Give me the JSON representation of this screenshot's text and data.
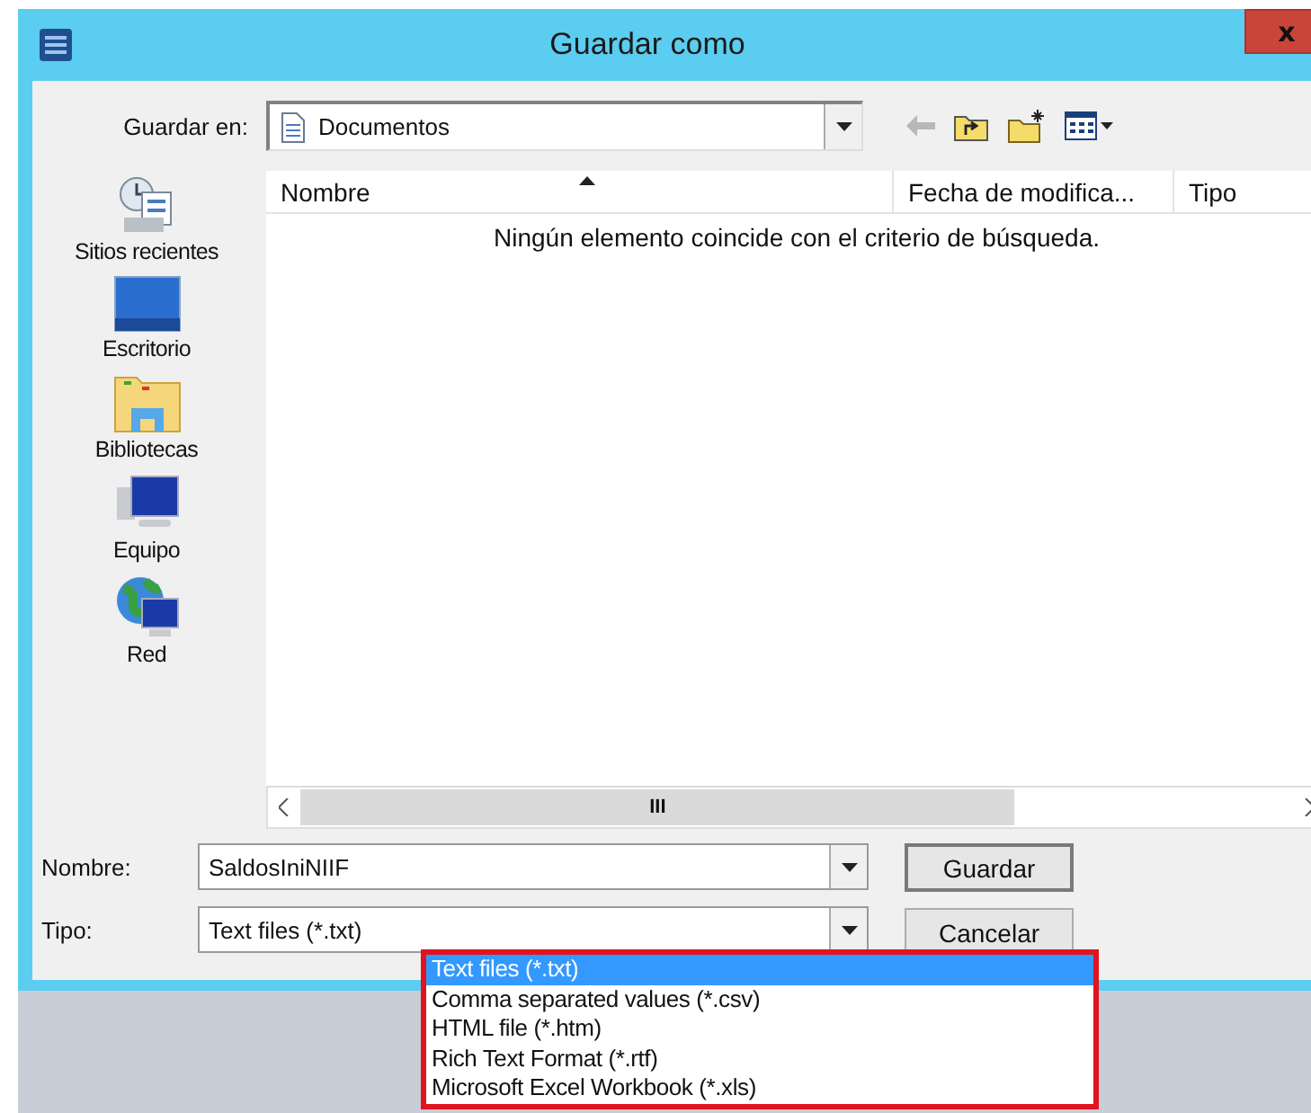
{
  "window": {
    "title": "Guardar como",
    "close": "x"
  },
  "save_in": {
    "label": "Guardar en:",
    "value": "Documentos"
  },
  "columns": [
    {
      "label": "Nombre",
      "sorted": true
    },
    {
      "label": "Fecha de modifica...",
      "sorted": false
    },
    {
      "label": "Tipo",
      "sorted": false
    }
  ],
  "empty_message": "Ningún elemento coincide con el criterio de búsqueda.",
  "places": [
    {
      "label": "Sitios recientes",
      "kind": "recent"
    },
    {
      "label": "Escritorio",
      "kind": "desktop"
    },
    {
      "label": "Bibliotecas",
      "kind": "libraries"
    },
    {
      "label": "Equipo",
      "kind": "computer"
    },
    {
      "label": "Red",
      "kind": "network"
    }
  ],
  "scrollbar": {
    "grip": "III"
  },
  "filename": {
    "label": "Nombre:",
    "value": "SaldosIniNIIF"
  },
  "filetype": {
    "label": "Tipo:",
    "value": "Text files (*.txt)"
  },
  "buttons": [
    "Guardar",
    "Cancelar"
  ],
  "filetype_options": [
    {
      "label": "Text files (*.txt)",
      "selected": true
    },
    {
      "label": "Comma separated values (*.csv)",
      "selected": false
    },
    {
      "label": "HTML file (*.htm)",
      "selected": false
    },
    {
      "label": "Rich Text Format (*.rtf)",
      "selected": false
    },
    {
      "label": "Microsoft Excel Workbook (*.xls)",
      "selected": false
    }
  ]
}
